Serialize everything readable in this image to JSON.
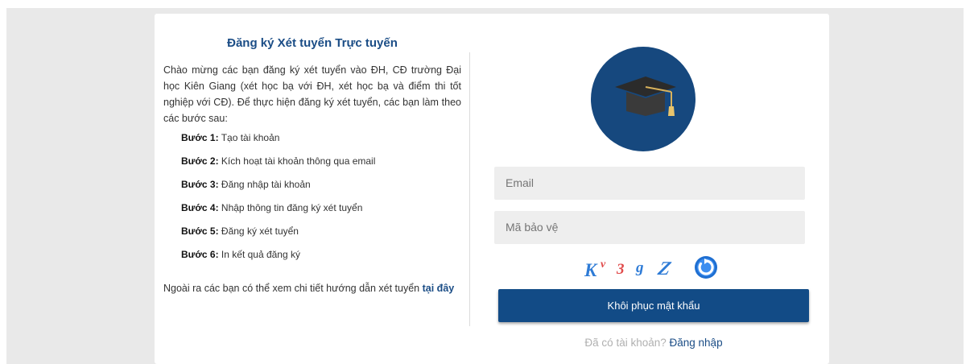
{
  "left": {
    "title": "Đăng ký Xét tuyển Trực tuyến",
    "intro": "Chào mừng các bạn đăng ký xét tuyển vào ĐH, CĐ trường Đại học Kiên Giang (xét học bạ với ĐH, xét học bạ và điểm thi tốt nghiệp với CĐ). Để thực hiện đăng ký xét tuyển, các bạn làm theo các bước sau:",
    "steps": [
      {
        "label": "Bước 1:",
        "text": "Tạo tài khoản"
      },
      {
        "label": "Bước 2:",
        "text": "Kích hoạt tài khoản thông qua email"
      },
      {
        "label": "Bước 3:",
        "text": "Đăng nhập tài khoản"
      },
      {
        "label": "Bước 4:",
        "text": "Nhập thông tin đăng ký xét tuyển"
      },
      {
        "label": "Bước 5:",
        "text": "Đăng ký xét tuyển"
      },
      {
        "label": "Bước 6:",
        "text": "In kết quả đăng ký"
      }
    ],
    "footer_text": "Ngoài ra các bạn có thể xem chi tiết hướng dẫn xét tuyển",
    "footer_link": "tại đây"
  },
  "form": {
    "avatar_icon": "graduation-cap-icon",
    "email_placeholder": "Email",
    "captcha_placeholder": "Mã bảo vệ",
    "captcha_chars": [
      "K",
      "v",
      "3",
      "g",
      "Z"
    ],
    "refresh_icon": "refresh-icon",
    "submit_label": "Khôi phục mật khẩu",
    "login_prompt": "Đã có tài khoản?",
    "login_link": "Đăng nhập"
  },
  "colors": {
    "brand": "#16487e",
    "button": "#124b86",
    "background": "#e9e9e9"
  }
}
